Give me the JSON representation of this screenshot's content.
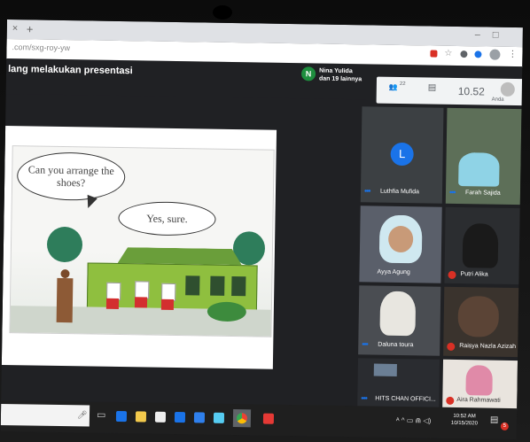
{
  "browser": {
    "new_tab_symbol": "+",
    "url": ".com/sxg-roy-yw",
    "window_controls": [
      "–",
      "□"
    ]
  },
  "meet": {
    "presenting_text": "lang melakukan presentasi",
    "presenter_avatar_letter": "N",
    "presenter_name": "Nina Yulida",
    "presenter_others": "dan 19 lainnya",
    "participant_count": "22",
    "clock": "10.52",
    "you_label": "Anda"
  },
  "slide": {
    "speech_bubble_1": "Can you arrange the shoes?",
    "speech_bubble_2": "Yes, sure."
  },
  "participants": [
    {
      "name": "Luthfia Mufida",
      "avatar_letter": "L",
      "status": "speaking"
    },
    {
      "name": "Farah Sajida",
      "status": "speaking"
    },
    {
      "name": "Ayya Agung",
      "status": "none"
    },
    {
      "name": "Putri Alika",
      "status": "muted"
    },
    {
      "name": "Daluna toura",
      "status": "speaking"
    },
    {
      "name": "Raisya Nazla Azizah",
      "status": "muted"
    },
    {
      "name": "HITS CHAN OFFICI...",
      "status": "speaking"
    },
    {
      "name": "Aira Rahmawati",
      "status": "muted"
    }
  ],
  "taskbar": {
    "time": "10:52 AM",
    "date": "10/15/2020",
    "tray_text": "ᴬ ^ ▭ ⋒ ◁)",
    "notification_count": "5"
  },
  "colors": {
    "meet_green": "#1e8e3e",
    "avatar_blue": "#1a73e8",
    "mute_red": "#d93025",
    "browser_bg": "#202124"
  }
}
